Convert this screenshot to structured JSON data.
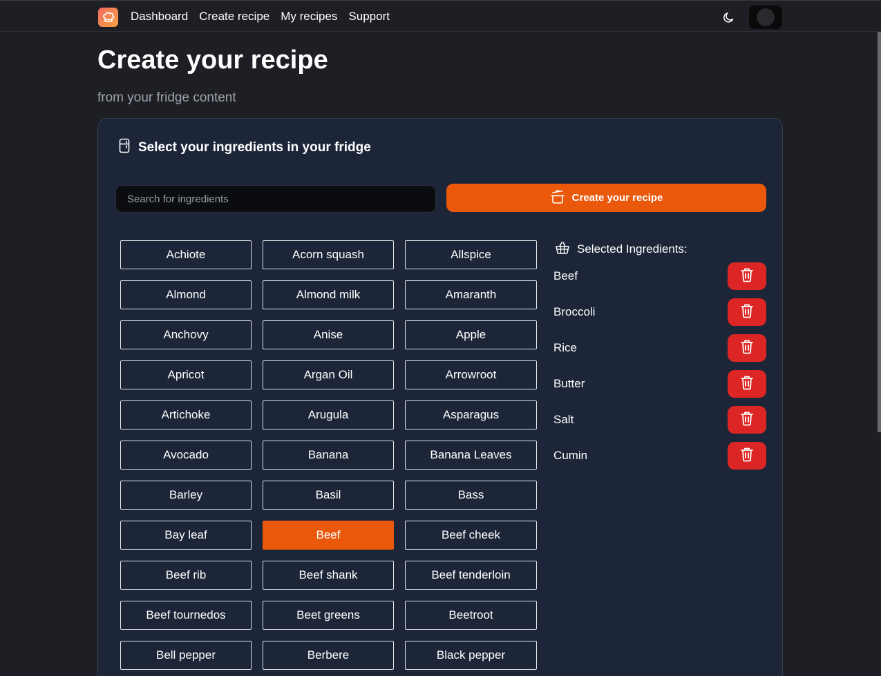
{
  "nav": {
    "items": [
      {
        "label": "Dashboard"
      },
      {
        "label": "Create recipe"
      },
      {
        "label": "My recipes"
      },
      {
        "label": "Support"
      }
    ]
  },
  "header": {
    "title": "Create your recipe",
    "subtitle": "from your fridge content"
  },
  "card": {
    "title": "Select your ingredients in your fridge",
    "search_placeholder": "Search for ingredients",
    "create_button_label": "Create your recipe"
  },
  "ingredients": [
    {
      "label": "Achiote",
      "selected": false
    },
    {
      "label": "Acorn squash",
      "selected": false
    },
    {
      "label": "Allspice",
      "selected": false
    },
    {
      "label": "Almond",
      "selected": false
    },
    {
      "label": "Almond milk",
      "selected": false
    },
    {
      "label": "Amaranth",
      "selected": false
    },
    {
      "label": "Anchovy",
      "selected": false
    },
    {
      "label": "Anise",
      "selected": false
    },
    {
      "label": "Apple",
      "selected": false
    },
    {
      "label": "Apricot",
      "selected": false
    },
    {
      "label": "Argan Oil",
      "selected": false
    },
    {
      "label": "Arrowroot",
      "selected": false
    },
    {
      "label": "Artichoke",
      "selected": false
    },
    {
      "label": "Arugula",
      "selected": false
    },
    {
      "label": "Asparagus",
      "selected": false
    },
    {
      "label": "Avocado",
      "selected": false
    },
    {
      "label": "Banana",
      "selected": false
    },
    {
      "label": "Banana Leaves",
      "selected": false
    },
    {
      "label": "Barley",
      "selected": false
    },
    {
      "label": "Basil",
      "selected": false
    },
    {
      "label": "Bass",
      "selected": false
    },
    {
      "label": "Bay leaf",
      "selected": false
    },
    {
      "label": "Beef",
      "selected": true
    },
    {
      "label": "Beef cheek",
      "selected": false
    },
    {
      "label": "Beef rib",
      "selected": false
    },
    {
      "label": "Beef shank",
      "selected": false
    },
    {
      "label": "Beef tenderloin",
      "selected": false
    },
    {
      "label": "Beef tournedos",
      "selected": false
    },
    {
      "label": "Beet greens",
      "selected": false
    },
    {
      "label": "Beetroot",
      "selected": false
    },
    {
      "label": "Bell pepper",
      "selected": false
    },
    {
      "label": "Berbere",
      "selected": false
    },
    {
      "label": "Black pepper",
      "selected": false
    }
  ],
  "selected_panel": {
    "title": "Selected Ingredients:",
    "items": [
      {
        "name": "Beef"
      },
      {
        "name": "Broccoli"
      },
      {
        "name": "Rice"
      },
      {
        "name": "Butter"
      },
      {
        "name": "Salt"
      },
      {
        "name": "Cumin"
      }
    ]
  },
  "colors": {
    "accent": "#ea580c",
    "danger": "#dc2626",
    "card_bg": "#1c2638",
    "page_bg": "#1e1f24"
  }
}
